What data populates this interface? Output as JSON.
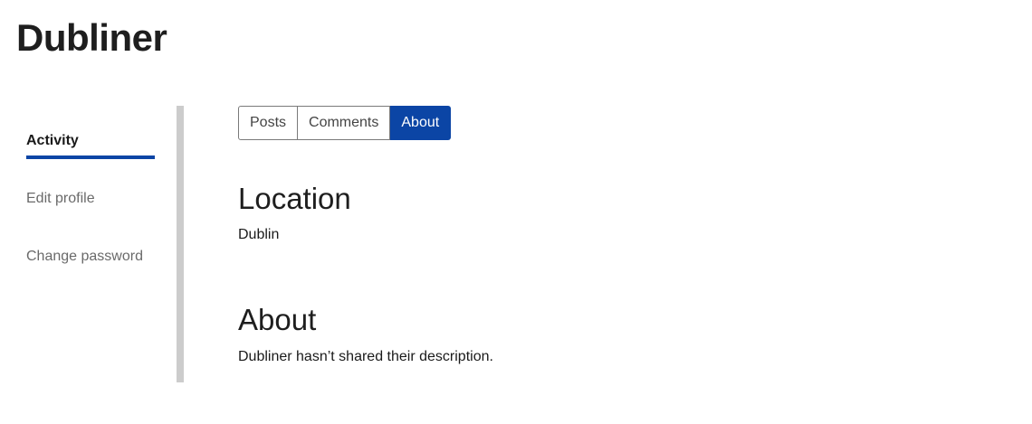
{
  "page": {
    "title": "Dubliner"
  },
  "sidebar": {
    "items": [
      {
        "label": "Activity",
        "active": true
      },
      {
        "label": "Edit profile",
        "active": false
      },
      {
        "label": "Change password",
        "active": false
      }
    ]
  },
  "tabs": [
    {
      "label": "Posts",
      "active": false
    },
    {
      "label": "Comments",
      "active": false
    },
    {
      "label": "About",
      "active": true
    }
  ],
  "about": {
    "location_heading": "Location",
    "location_value": "Dublin",
    "about_heading": "About",
    "about_value": "Dubliner hasn’t shared their description."
  },
  "colors": {
    "accent": "#0b45a5",
    "divider": "#cccccc",
    "muted_text": "#6a6a6a"
  }
}
